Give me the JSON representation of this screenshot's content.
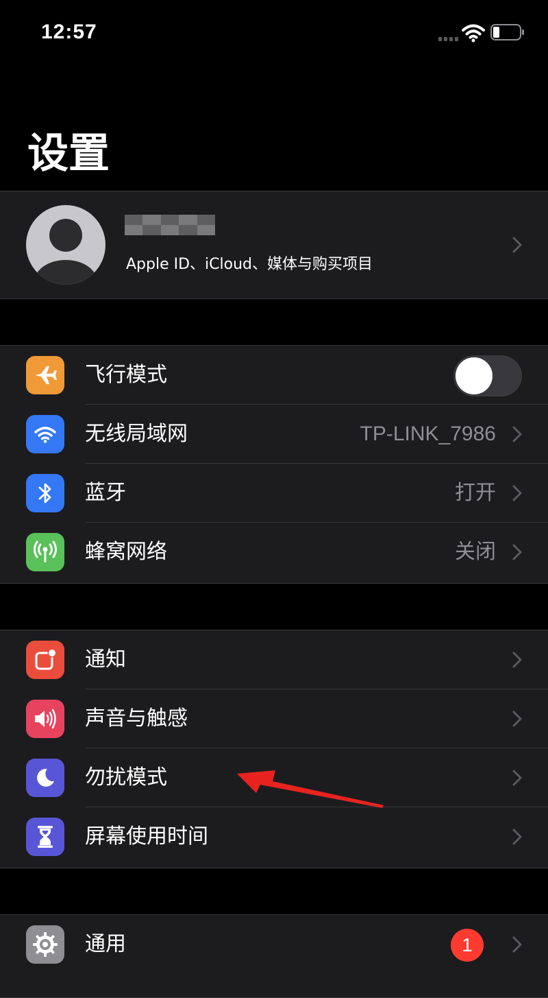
{
  "status_bar": {
    "time": "12:57"
  },
  "page": {
    "title": "设置"
  },
  "profile": {
    "subtitle": "Apple ID、iCloud、媒体与购买项目"
  },
  "group_connectivity": {
    "items": [
      {
        "label": "飞行模式",
        "icon": "airplane-icon",
        "icon_color": "#f09a37",
        "toggle_on": false
      },
      {
        "label": "无线局域网",
        "icon": "wifi-icon",
        "icon_color": "#3478f6",
        "value": "TP-LINK_7986"
      },
      {
        "label": "蓝牙",
        "icon": "bluetooth-icon",
        "icon_color": "#3478f6",
        "value": "打开"
      },
      {
        "label": "蜂窝网络",
        "icon": "cellular-icon",
        "icon_color": "#5ac05a",
        "value": "关闭"
      }
    ]
  },
  "group_notifications": {
    "items": [
      {
        "label": "通知",
        "icon": "notifications-icon",
        "icon_color": "#eb4d3d"
      },
      {
        "label": "声音与触感",
        "icon": "speaker-icon",
        "icon_color": "#e8435e"
      },
      {
        "label": "勿扰模式",
        "icon": "moon-icon",
        "icon_color": "#5856d6"
      },
      {
        "label": "屏幕使用时间",
        "icon": "hourglass-icon",
        "icon_color": "#5856d6"
      }
    ]
  },
  "group_general": {
    "items": [
      {
        "label": "通用",
        "icon": "gear-icon",
        "icon_color": "#8e8e93",
        "badge": "1"
      }
    ]
  },
  "colors": {
    "background": "#000000",
    "group_background": "#1c1c1e",
    "separator": "#38383a",
    "secondary_text": "#8e8e93",
    "annotation_arrow": "#e8231f"
  }
}
